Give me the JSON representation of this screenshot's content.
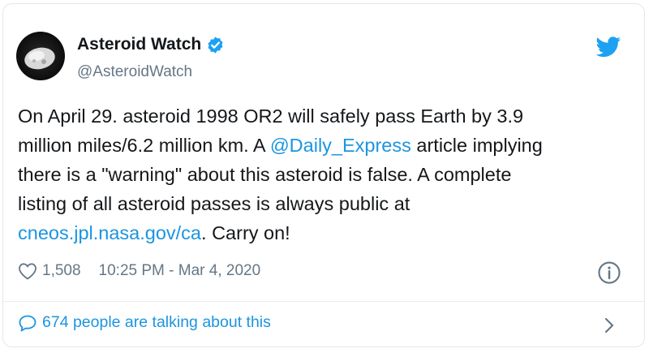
{
  "tweet": {
    "display_name": "Asteroid Watch",
    "handle": "@AsteroidWatch",
    "text_lines": [
      [
        "On April 29. asteroid 1998 OR2 will safely pass Earth by 3.9",
        "",
        ""
      ],
      [
        "million miles/6.2 million km. A ",
        "@Daily_Express",
        " article implying"
      ],
      [
        "there is a \"warning\" about this asteroid is false. A complete",
        "",
        ""
      ],
      [
        "listing of all asteroid passes is always public at",
        "",
        ""
      ],
      [
        "",
        "cneos.jpl.nasa.gov/ca",
        ". Carry on!"
      ]
    ],
    "likes": "1,508",
    "timestamp": "10:25 PM - Mar 4, 2020",
    "talking": "674 people are talking about this"
  },
  "icons": {
    "avatar": "asteroid-avatar",
    "verified": "verified-badge-icon",
    "brand": "twitter-bird-icon",
    "like": "heart-icon",
    "info": "info-icon",
    "reply": "speech-bubble-icon",
    "more": "chevron-right-icon"
  },
  "colors": {
    "link": "#1b95e0",
    "text": "#14171a",
    "muted": "#657786",
    "verified": "#1da1f2",
    "border": "#e1e8ed"
  }
}
